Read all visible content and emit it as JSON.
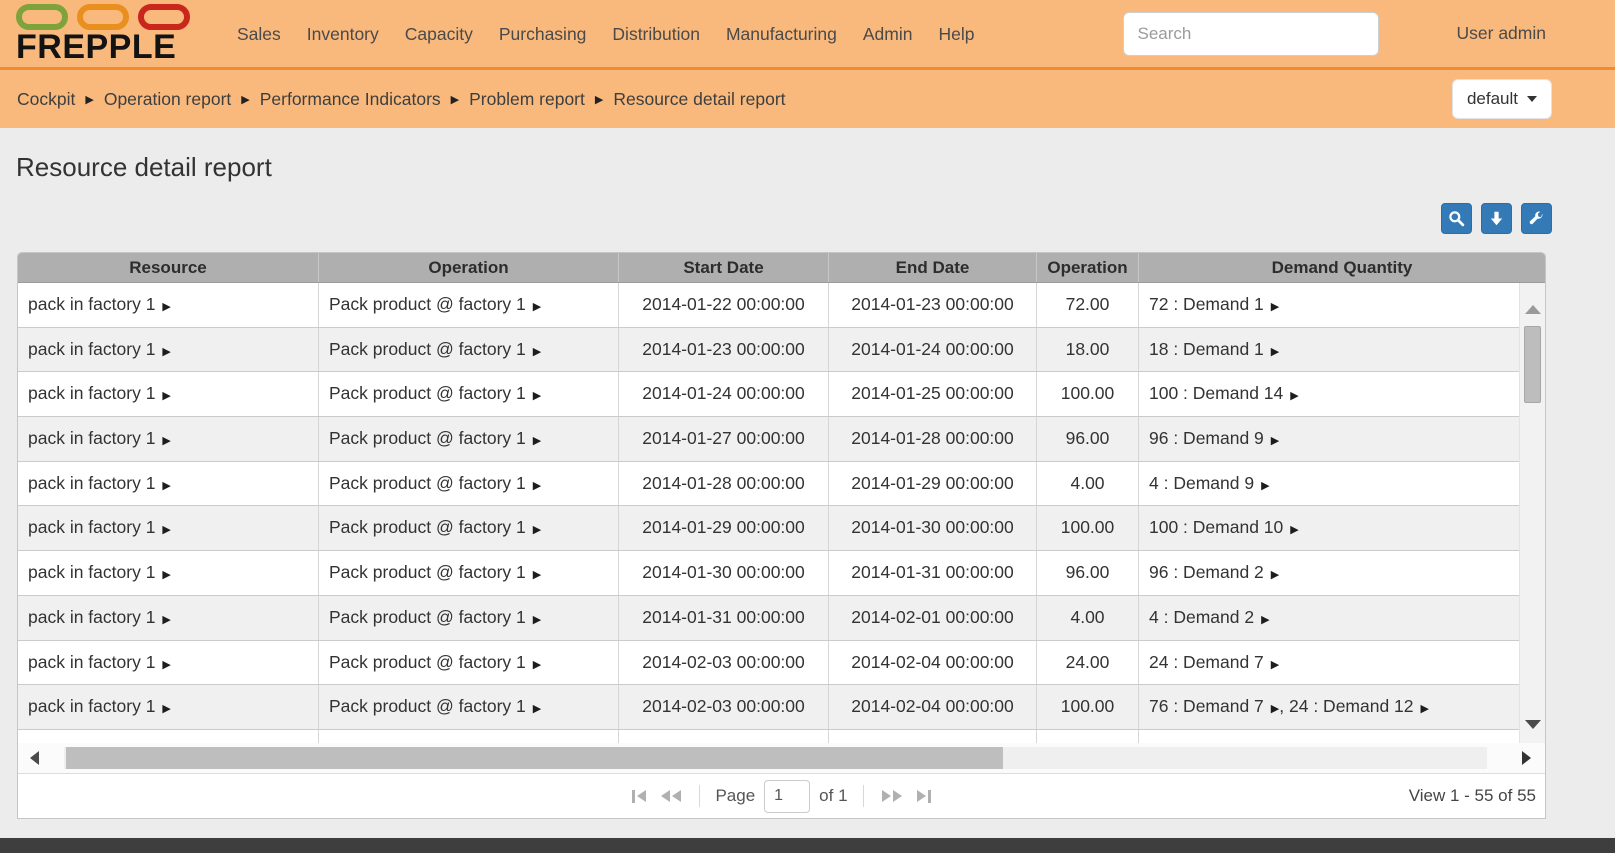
{
  "brand": {
    "name": "FREPPLE",
    "capsule_colors": [
      "#7FA33C",
      "#E88F1E",
      "#C9271B"
    ]
  },
  "nav": {
    "items": [
      "Sales",
      "Inventory",
      "Capacity",
      "Purchasing",
      "Distribution",
      "Manufacturing",
      "Admin",
      "Help"
    ],
    "search_placeholder": "Search",
    "user": "User admin"
  },
  "breadcrumb": {
    "items": [
      "Cockpit",
      "Operation report",
      "Performance Indicators",
      "Problem report",
      "Resource detail report"
    ],
    "view_selector": "default"
  },
  "page": {
    "title": "Resource detail report"
  },
  "toolbar": {
    "buttons": [
      {
        "icon": "search-icon"
      },
      {
        "icon": "download-icon"
      },
      {
        "icon": "wrench-icon"
      }
    ],
    "accent_color": "#337AB7"
  },
  "table": {
    "columns": [
      "Resource",
      "Operation",
      "Start Date",
      "End Date",
      "Operation",
      "Demand Quantity"
    ],
    "rows": [
      {
        "resource": "pack in factory 1",
        "operation": "Pack product @ factory 1",
        "start": "2014-01-22 00:00:00",
        "end": "2014-01-23 00:00:00",
        "quantity": "72.00",
        "demands": [
          "72 : Demand 1"
        ]
      },
      {
        "resource": "pack in factory 1",
        "operation": "Pack product @ factory 1",
        "start": "2014-01-23 00:00:00",
        "end": "2014-01-24 00:00:00",
        "quantity": "18.00",
        "demands": [
          "18 : Demand 1"
        ]
      },
      {
        "resource": "pack in factory 1",
        "operation": "Pack product @ factory 1",
        "start": "2014-01-24 00:00:00",
        "end": "2014-01-25 00:00:00",
        "quantity": "100.00",
        "demands": [
          "100 : Demand 14"
        ]
      },
      {
        "resource": "pack in factory 1",
        "operation": "Pack product @ factory 1",
        "start": "2014-01-27 00:00:00",
        "end": "2014-01-28 00:00:00",
        "quantity": "96.00",
        "demands": [
          "96 : Demand 9"
        ]
      },
      {
        "resource": "pack in factory 1",
        "operation": "Pack product @ factory 1",
        "start": "2014-01-28 00:00:00",
        "end": "2014-01-29 00:00:00",
        "quantity": "4.00",
        "demands": [
          "4 : Demand 9"
        ]
      },
      {
        "resource": "pack in factory 1",
        "operation": "Pack product @ factory 1",
        "start": "2014-01-29 00:00:00",
        "end": "2014-01-30 00:00:00",
        "quantity": "100.00",
        "demands": [
          "100 : Demand 10"
        ]
      },
      {
        "resource": "pack in factory 1",
        "operation": "Pack product @ factory 1",
        "start": "2014-01-30 00:00:00",
        "end": "2014-01-31 00:00:00",
        "quantity": "96.00",
        "demands": [
          "96 : Demand 2"
        ]
      },
      {
        "resource": "pack in factory 1",
        "operation": "Pack product @ factory 1",
        "start": "2014-01-31 00:00:00",
        "end": "2014-02-01 00:00:00",
        "quantity": "4.00",
        "demands": [
          "4 : Demand 2"
        ]
      },
      {
        "resource": "pack in factory 1",
        "operation": "Pack product @ factory 1",
        "start": "2014-02-03 00:00:00",
        "end": "2014-02-04 00:00:00",
        "quantity": "24.00",
        "demands": [
          "24 : Demand 7"
        ]
      },
      {
        "resource": "pack in factory 1",
        "operation": "Pack product @ factory 1",
        "start": "2014-02-03 00:00:00",
        "end": "2014-02-04 00:00:00",
        "quantity": "100.00",
        "demands": [
          "76 : Demand 7",
          "24 : Demand 12"
        ]
      }
    ]
  },
  "pager": {
    "page_label": "Page",
    "page_value": "1",
    "of_label": "of 1",
    "status": "View 1 - 55 of 55"
  }
}
